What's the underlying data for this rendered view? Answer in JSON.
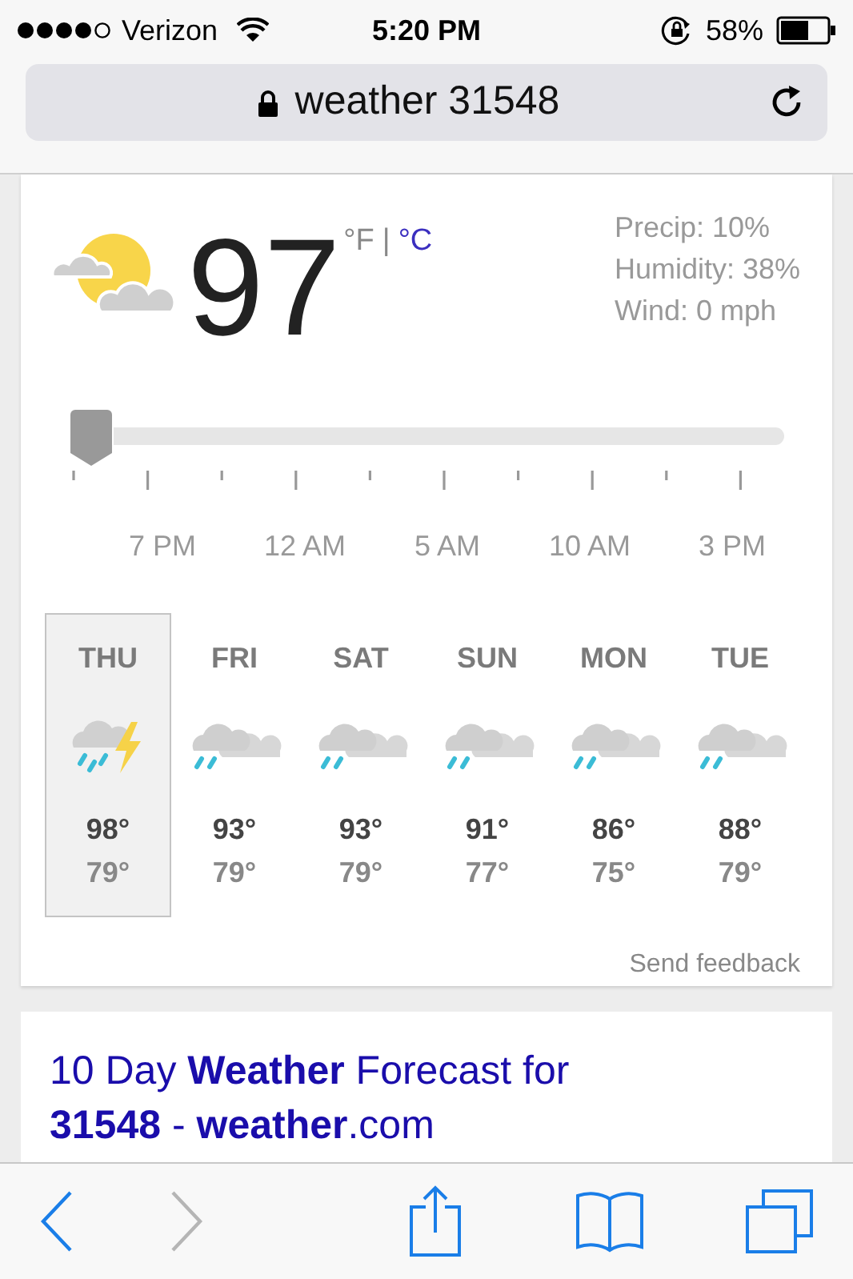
{
  "status_bar": {
    "carrier": "Verizon",
    "time": "5:20 PM",
    "battery": "58%"
  },
  "address_bar": {
    "text": "weather 31548"
  },
  "weather": {
    "temperature": "97",
    "units": [
      {
        "label": "°F",
        "selected": true
      },
      {
        "label": "°C",
        "selected": false
      }
    ],
    "unit_separator": "|",
    "details": [
      "Precip: 10%",
      "Humidity: 38%",
      "Wind: 0 mph"
    ],
    "timeline": {
      "level": 0,
      "labels": [
        "7 PM",
        "12 AM",
        "5 AM",
        "10 AM",
        "3 PM"
      ]
    },
    "days": [
      {
        "day": "THU",
        "kind": "storm",
        "high": "98°",
        "low": "79°",
        "selected": true
      },
      {
        "day": "FRI",
        "kind": "rain",
        "high": "93°",
        "low": "79°",
        "selected": false
      },
      {
        "day": "SAT",
        "kind": "rain",
        "high": "93°",
        "low": "79°",
        "selected": false
      },
      {
        "day": "SUN",
        "kind": "rain",
        "high": "91°",
        "low": "77°",
        "selected": false
      },
      {
        "day": "MON",
        "kind": "rain",
        "high": "86°",
        "low": "75°",
        "selected": false
      },
      {
        "day": "TUE",
        "kind": "rain",
        "high": "88°",
        "low": "79°",
        "selected": false
      }
    ],
    "feedback": "Send feedback"
  },
  "result": {
    "title": "10 Day **Weather** Forecast for **31548** - **weather**.com"
  },
  "toolbar": [
    {
      "kind": "back",
      "disabled": false
    },
    {
      "kind": "forward",
      "disabled": true
    },
    {
      "kind": "share",
      "disabled": false
    },
    {
      "kind": "bookmarks",
      "disabled": false
    },
    {
      "kind": "tabs",
      "disabled": false
    }
  ]
}
